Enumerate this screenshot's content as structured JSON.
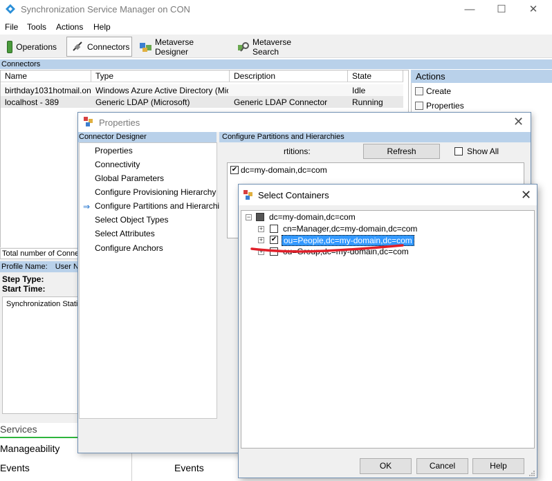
{
  "window": {
    "title": "Synchronization Service Manager on CON",
    "caption_min": "—",
    "caption_max": "☐",
    "caption_close": "✕"
  },
  "menu": [
    "File",
    "Tools",
    "Actions",
    "Help"
  ],
  "toolbar": {
    "operations": "Operations",
    "connectors": "Connectors",
    "metaverse_designer": "Metaverse Designer",
    "metaverse_search": "Metaverse Search"
  },
  "connectors": {
    "header": "Connectors",
    "columns": [
      "Name",
      "Type",
      "Description",
      "State"
    ],
    "rows": [
      {
        "name": "birthday1031hotmail.on...",
        "type": "Windows Azure Active Directory (Micr...",
        "description": "",
        "state": "Idle"
      },
      {
        "name": "localhost - 389",
        "type": "Generic LDAP (Microsoft)",
        "description": "Generic LDAP Connector",
        "state": "Running"
      }
    ]
  },
  "actions": {
    "header": "Actions",
    "items": [
      "Create",
      "Properties"
    ]
  },
  "lower": {
    "total": "Total number of Connec",
    "profile_name": "Profile Name:",
    "user_name": "User Nar",
    "step_type": "Step Type:",
    "start_time": "Start Time:",
    "sync_stats": "Synchronization Statis",
    "services": "Services",
    "manageability": "Manageability",
    "events_left": "Events",
    "events_right": "Events"
  },
  "properties": {
    "title": "Properties",
    "close": "✕",
    "designer_header": "Connector Designer",
    "nav": [
      "Properties",
      "Connectivity",
      "Global Parameters",
      "Configure Provisioning Hierarchy",
      "Configure Partitions and Hierarchies",
      "Select Object Types",
      "Select Attributes",
      "Configure Anchors"
    ],
    "nav_arrow": "⇒",
    "panel_header": "Configure Partitions and Hierarchies",
    "partitions_label": "rtitions:",
    "refresh": "Refresh",
    "show_all": "Show All",
    "partition_item": "dc=my-domain,dc=com",
    "partition_checkmark": "✔"
  },
  "select_containers": {
    "title": "Select Containers",
    "close": "✕",
    "expander_minus": "−",
    "expander_plus": "+",
    "checkmark": "✔",
    "root": "dc=my-domain,dc=com",
    "children": [
      {
        "label": "cn=Manager,dc=my-domain,dc=com",
        "checked": false
      },
      {
        "label": "ou=People,dc=my-domain,dc=com",
        "checked": true
      },
      {
        "label": "ou=Group,dc=my-domain,dc=com",
        "checked": false
      }
    ],
    "ok": "OK",
    "cancel": "Cancel",
    "help": "Help"
  },
  "colors": {
    "header_blue": "#b9d1ea",
    "selection_blue": "#3399ff",
    "annotation_red": "#e0202a"
  }
}
